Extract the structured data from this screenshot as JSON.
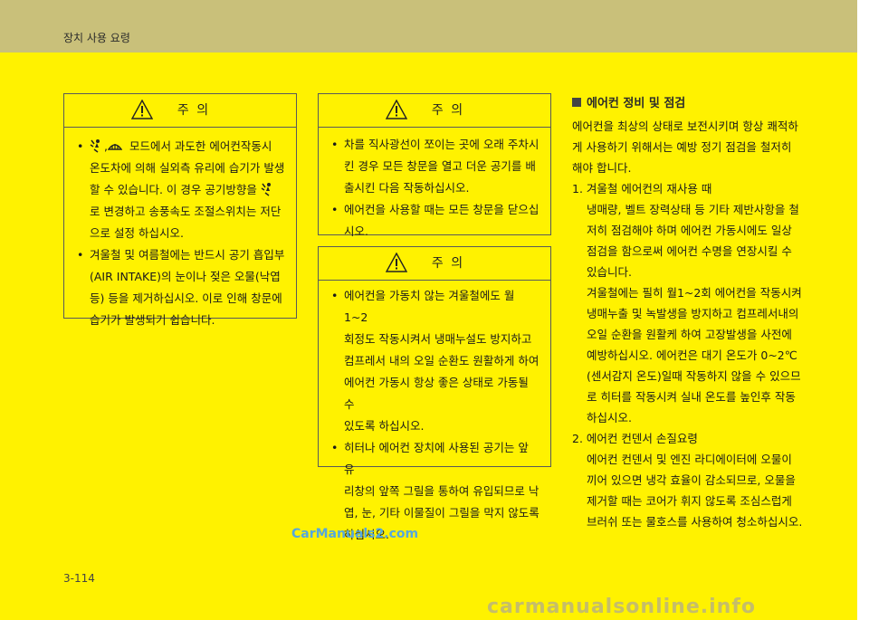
{
  "header": {
    "title": "장치 사용 요령"
  },
  "box_left": {
    "title": "주    의",
    "items": [
      {
        "lines": [
          "모드에서 과도한 에어컨작동시",
          "온도차에 의해 실외측 유리에 습기가 발생",
          "할 수 있습니다. 이 경우 공기방향을",
          "로 변경하고 송풍속도 조절스위치는 저단",
          "으로 설정 하십시오."
        ]
      },
      {
        "lines": [
          "겨울철 및 여름철에는 반드시 공기 흡입부",
          "(AIR INTAKE)의 눈이나 젖은 오물(낙엽",
          "등) 등을 제거하십시오. 이로 인해 창문에",
          "습기가 발생되기 쉽습니다."
        ]
      }
    ],
    "comma": ","
  },
  "box_mid_top": {
    "title": "주    의",
    "items": [
      {
        "lines": [
          "차를 직사광선이 쪼이는 곳에 오래 주차시",
          "킨 경우 모든 창문을 열고 더운 공기를 배",
          "출시킨 다음 작동하십시오."
        ]
      },
      {
        "lines": [
          "에어컨을 사용할 때는 모든 창문을 닫으십",
          "시오."
        ]
      }
    ]
  },
  "box_mid_bottom": {
    "title": "주    의",
    "items": [
      {
        "lines": [
          "에어컨을 가동치 않는 겨울철에도 월 1~2",
          "회정도 작동시켜서 냉매누설도 방지하고",
          "컴프레서 내의 오일 순환도 원활하게 하여",
          "에어컨 가동시 항상 좋은 상태로 가동될 수",
          "있도록 하십시오."
        ]
      },
      {
        "lines": [
          "히터나 에어컨 장치에 사용된 공기는 앞 유",
          "리창의 앞쪽 그릴을 통하여 유입되므로 낙",
          "엽, 눈, 기타 이물질이 그릴을 막지 않도록",
          "하십시오."
        ]
      }
    ]
  },
  "section": {
    "title": "에어컨 정비 및 점검",
    "intro": [
      "에어컨을 최상의 상태로 보전시키며 항상 쾌적하",
      "게 사용하기 위해서는 예방 정기 점검을 철저히",
      "해야 합니다."
    ],
    "item1_title": "1.  겨울철 에어컨의 재사용 때",
    "item1_body": [
      "냉매량, 벨트 장력상태 등 기타 제반사항을 철",
      "저히 점검해야 하며 에어컨 가동시에도 일상",
      "점검을 함으로써 에어컨 수명을 연장시킬 수",
      "있습니다.",
      "겨울철에는 필히 월1~2회 에어컨을 작동시켜",
      "냉매누출 및 녹발생을 방지하고 컴프레서내의",
      "오일 순환을 원활케 하여 고장발생을 사전에",
      "예방하십시오.  에어컨은 대기 온도가 0~2℃",
      "(센서감지 온도)일때 작동하지 않을 수 있으므",
      "로 히터를 작동시켜 실내 온도를 높인후 작동",
      "하십시오."
    ],
    "item2_title": "2.  에어컨 컨덴서 손질요령",
    "item2_body": [
      "에어컨 컨덴서 및 엔진 라디에이터에 오물이",
      "끼어 있으면 냉각 효율이 감소되므로, 오물을",
      "제거할 때는 코어가 휘지 않도록 조심스럽게",
      "브러쉬 또는 물호스를 사용하여 청소하십시오."
    ]
  },
  "page_number": "3-114",
  "watermark": "CarManuals2.com",
  "bottom_watermark": "carmanualsonline.info",
  "colors": {
    "page_yellow": "#fff200",
    "header_band": "#c9c07a",
    "watermark_blue": "#55a8dc"
  },
  "icons": [
    "warning-triangle-icon",
    "defrost-floor-mode-icon",
    "defrost-mode-icon"
  ]
}
